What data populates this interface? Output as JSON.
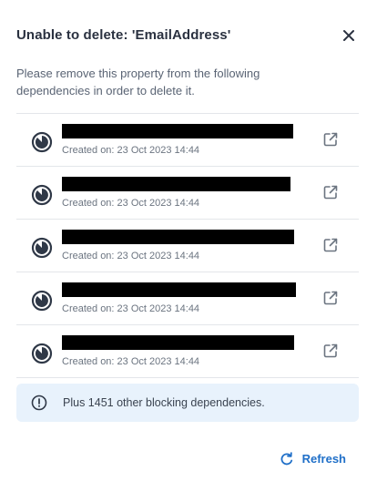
{
  "dialog": {
    "title": "Unable to delete: 'EmailAddress'",
    "close_icon": "close-icon",
    "description": "Please remove this property from the following dependencies in order to delete it."
  },
  "dependencies": [
    {
      "name": "[redacted]",
      "created": "Created on: 23 Oct 2023 14:44",
      "status_icon": "status-clock-icon",
      "link_icon": "external-link-icon"
    },
    {
      "name": "[redacted]",
      "created": "Created on: 23 Oct 2023 14:44",
      "status_icon": "status-clock-icon",
      "link_icon": "external-link-icon"
    },
    {
      "name": "[redacted]",
      "created": "Created on: 23 Oct 2023 14:44",
      "status_icon": "status-clock-icon",
      "link_icon": "external-link-icon"
    },
    {
      "name": "[redacted]",
      "created": "Created on: 23 Oct 2023 14:44",
      "status_icon": "status-clock-icon",
      "link_icon": "external-link-icon"
    },
    {
      "name": "[redacted]",
      "created": "Created on: 23 Oct 2023 14:44",
      "status_icon": "status-clock-icon",
      "link_icon": "external-link-icon"
    }
  ],
  "notice": {
    "icon": "info-icon",
    "text": "Plus 1451 other blocking dependencies."
  },
  "refresh": {
    "icon": "refresh-icon",
    "label": "Refresh"
  },
  "colors": {
    "accent": "#1f6fc8",
    "notice_bg": "#e8f2fc",
    "divider": "#e3e6ea",
    "title": "#2a3140"
  }
}
